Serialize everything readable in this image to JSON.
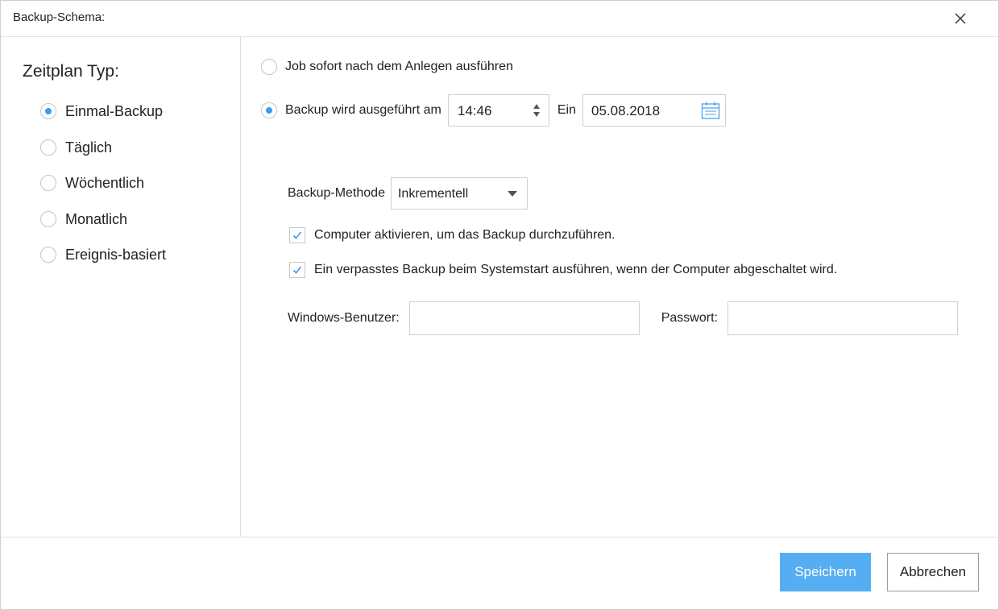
{
  "dialog": {
    "title": "Backup-Schema:",
    "close_icon": "close-icon"
  },
  "sidebar": {
    "heading": "Zeitplan Typ:",
    "options": [
      {
        "label": "Einmal-Backup",
        "selected": true
      },
      {
        "label": "Täglich",
        "selected": false
      },
      {
        "label": "Wöchentlich",
        "selected": false
      },
      {
        "label": "Monatlich",
        "selected": false
      },
      {
        "label": "Ereignis-basiert",
        "selected": false
      }
    ]
  },
  "schedule": {
    "run_now_label": "Job sofort nach dem Anlegen ausführen",
    "run_now_selected": false,
    "run_at_label": "Backup wird ausgeführt am",
    "run_at_selected": true,
    "time_value": "14:46",
    "on_label": "Ein",
    "date_value": "05.08.2018",
    "calendar_icon": "calendar-icon"
  },
  "method": {
    "label": "Backup-Methode",
    "selected": "Inkrementell"
  },
  "options": {
    "wake_label": "Computer aktivieren, um das Backup durchzuführen.",
    "wake_checked": true,
    "missed_label": "Ein verpasstes Backup beim Systemstart ausführen, wenn der Computer abgeschaltet wird.",
    "missed_checked": true
  },
  "credentials": {
    "user_label": "Windows-Benutzer:",
    "user_value": "",
    "password_label": "Passwort:",
    "password_value": ""
  },
  "footer": {
    "save_label": "Speichern",
    "cancel_label": "Abbrechen"
  },
  "colors": {
    "accent": "#3e9af0",
    "primary_button": "#55aef2"
  }
}
